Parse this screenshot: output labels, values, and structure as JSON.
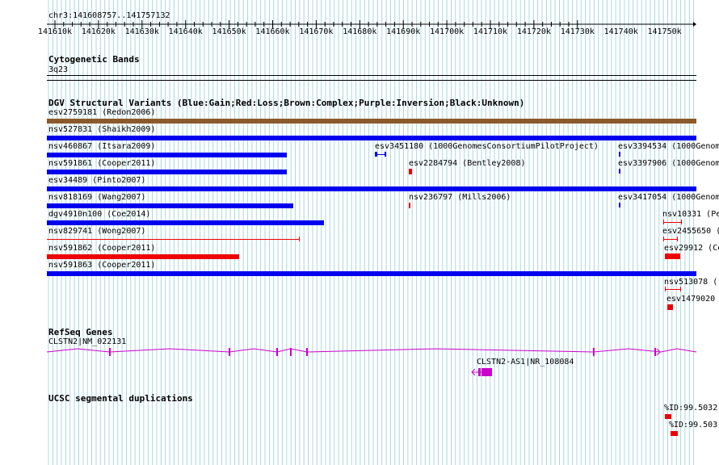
{
  "coords": "chr3:141608757..141757132",
  "ruler_ticks": [
    "141610k",
    "141620k",
    "141630k",
    "141640k",
    "141650k",
    "141660k",
    "141670k",
    "141680k",
    "141690k",
    "141700k",
    "141710k",
    "141720k",
    "141730k",
    "141740k",
    "141750k"
  ],
  "tracks": {
    "cyto": {
      "title": "Cytogenetic Bands",
      "band": "3q23"
    },
    "dgv": {
      "title": "DGV Structural Variants (Blue:Gain;Red:Loss;Brown:Complex;Purple:Inversion;Black:Unknown)",
      "labels": [
        "esv2759181 (Redon2006)",
        "nsv527831 (Shaikh2009)",
        "nsv460867 (Itsara2009)",
        "esv3451180 (1000GenomesConsortiumPilotProject)",
        "esv3394534 (1000Genom",
        "nsv591861 (Cooper2011)",
        "esv2284794 (Bentley2008)",
        "esv3397906 (1000Genom",
        "esv34489 (Pinto2007)",
        "nsv818169 (Wang2007)",
        "nsv236797 (Mills2006)",
        "esv3417054 (1000Genom",
        "dgv4910n100 (Coe2014)",
        "nsv10331 (Pe",
        "nsv829741 (Wong2007)",
        "esv2455650 (",
        "nsv591862 (Cooper2011)",
        "esv29912 (Co",
        "nsv591863 (Cooper2011)",
        "nsv513078 (",
        "esv1479020"
      ]
    },
    "refseq": {
      "title": "RefSeq Genes",
      "gene1": "CLSTN2|NM_022131",
      "gene2": "CLSTN2-AS1|NR_108084"
    },
    "segdup": {
      "title": "UCSC segmental duplications",
      "item1": "%ID:99.5032",
      "item2": "%ID:99.503"
    }
  },
  "colors": {
    "gain": "#0000ee",
    "loss": "#ee0000",
    "complex": "#8b5a2b",
    "gene": "#cc00cc",
    "grid": "#a8d8e0"
  }
}
